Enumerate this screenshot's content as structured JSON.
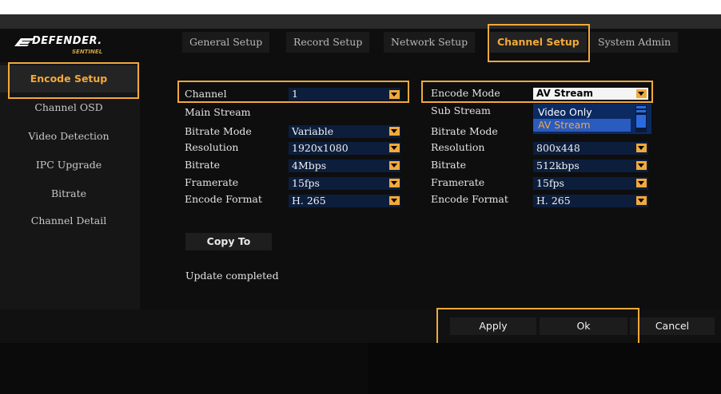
{
  "brand": {
    "name": "DEFENDER.",
    "tagline": "SENTINEL"
  },
  "tabs": [
    {
      "label": "General Setup"
    },
    {
      "label": "Record Setup"
    },
    {
      "label": "Network Setup"
    },
    {
      "label": "Channel Setup"
    },
    {
      "label": "System Admin"
    }
  ],
  "active_tab": "Channel Setup",
  "sidebar": {
    "items": [
      {
        "label": "Encode Setup"
      },
      {
        "label": "Channel OSD"
      },
      {
        "label": "Video Detection"
      },
      {
        "label": "IPC Upgrade"
      },
      {
        "label": "Bitrate"
      },
      {
        "label": "Channel Detail"
      }
    ],
    "active": "Encode Setup"
  },
  "form": {
    "channel": {
      "label": "Channel",
      "value": "1"
    },
    "main_stream": {
      "heading": "Main Stream",
      "bitrate_mode": {
        "label": "Bitrate Mode",
        "value": "Variable"
      },
      "resolution": {
        "label": "Resolution",
        "value": "1920x1080"
      },
      "bitrate": {
        "label": "Bitrate",
        "value": "4Mbps"
      },
      "framerate": {
        "label": "Framerate",
        "value": "15fps"
      },
      "encode_format": {
        "label": "Encode Format",
        "value": "H. 265"
      }
    },
    "encode_mode": {
      "label": "Encode Mode",
      "value": "AV Stream",
      "options": [
        "Video Only",
        "AV Stream"
      ],
      "selected_option": "AV Stream"
    },
    "sub_stream": {
      "heading": "Sub Stream",
      "bitrate_mode": {
        "label": "Bitrate Mode"
      },
      "resolution": {
        "label": "Resolution",
        "value": "800x448"
      },
      "bitrate": {
        "label": "Bitrate",
        "value": "512kbps"
      },
      "framerate": {
        "label": "Framerate",
        "value": "15fps"
      },
      "encode_format": {
        "label": "Encode Format",
        "value": "H. 265"
      }
    }
  },
  "copy_button": "Copy To",
  "status": "Update completed",
  "footer": {
    "apply": "Apply",
    "ok": "Ok",
    "cancel": "Cancel"
  },
  "colors": {
    "accent": "#f2a93b",
    "field_bg": "#0c1e3c",
    "dropdown_bg": "#0c2a62",
    "selected_option_bg": "#2a5bbf"
  },
  "icons": [
    "defender-logo-icon",
    "dropdown-arrow-icon"
  ]
}
